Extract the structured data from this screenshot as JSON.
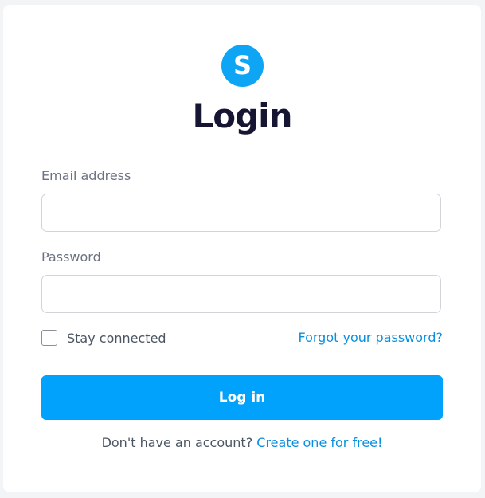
{
  "logo": {
    "letter": "S",
    "color": "#0ea5f5"
  },
  "page": {
    "title": "Login"
  },
  "form": {
    "email_label": "Email address",
    "email_value": "",
    "password_label": "Password",
    "password_value": "",
    "remember_label": "Stay connected",
    "remember_checked": false,
    "forgot_link": "Forgot your password?",
    "submit_label": "Log in"
  },
  "footer": {
    "prompt": "Don't have an account? ",
    "signup_link": "Create one for free!"
  },
  "colors": {
    "accent": "#00a2fb",
    "link": "#0a8fe0",
    "title": "#161633"
  }
}
